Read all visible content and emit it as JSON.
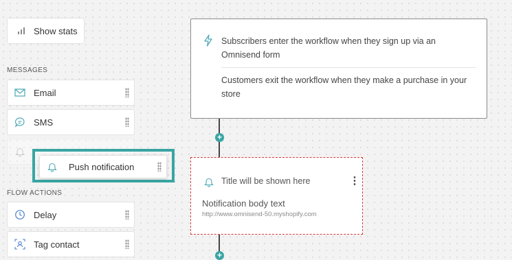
{
  "sidebar": {
    "show_stats_label": "Show stats",
    "messages_heading": "MESSAGES",
    "messages": [
      {
        "label": "Email",
        "icon": "email-icon"
      },
      {
        "label": "SMS",
        "icon": "sms-icon"
      }
    ],
    "flow_actions_heading": "FLOW ACTIONS",
    "flow_actions": [
      {
        "label": "Delay",
        "icon": "clock-icon"
      },
      {
        "label": "Tag contact",
        "icon": "tag-contact-icon"
      }
    ]
  },
  "dragging": {
    "label": "Push notification",
    "icon": "bell-icon"
  },
  "trigger": {
    "enter_text": "Subscribers enter the workflow when they sign up via an Omnisend form",
    "exit_text": "Customers exit the workflow when they make a purchase in your store"
  },
  "push_node": {
    "title": "Title will be shown here",
    "body": "Notification body text",
    "url": "http://www.omnisend-50.myshopify.com"
  },
  "colors": {
    "accent": "#3aa5a3",
    "error_border": "#d9373a",
    "icon_teal": "#4aa6b6"
  }
}
